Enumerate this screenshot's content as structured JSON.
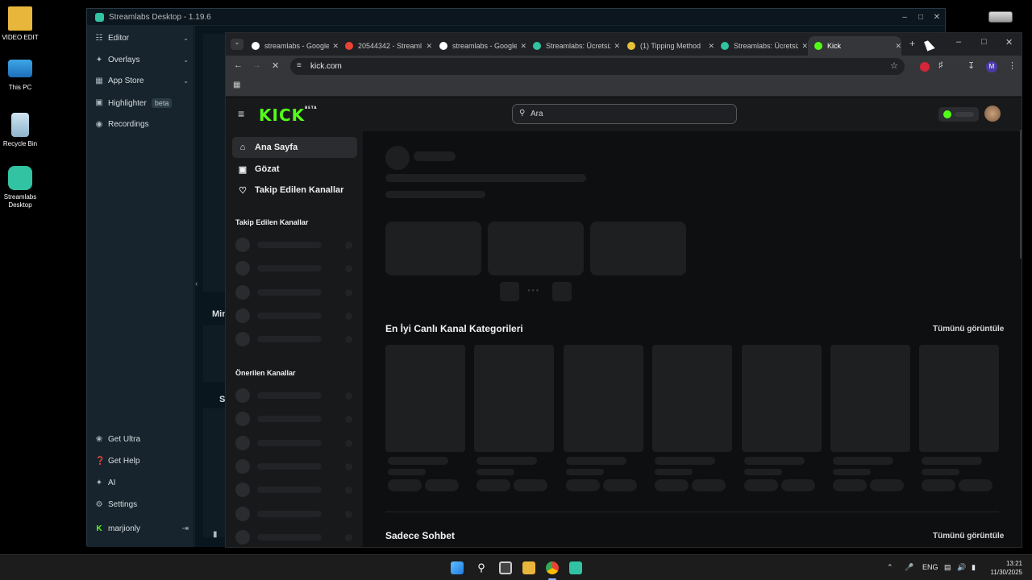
{
  "desktop": {
    "icons": [
      {
        "label": "VIDEO EDIT",
        "icon": "folder-icon"
      },
      {
        "label": "This PC",
        "icon": "monitor-icon"
      },
      {
        "label": "Recycle Bin",
        "icon": "recycle-bin-icon"
      },
      {
        "label": "Streamlabs Desktop",
        "icon": "streamlabs-icon"
      }
    ]
  },
  "streamlabs": {
    "title": "Streamlabs Desktop - 1.19.6",
    "nav": [
      {
        "label": "Editor"
      },
      {
        "label": "Overlays"
      },
      {
        "label": "App Store"
      },
      {
        "label": "Highlighter",
        "badge": "beta"
      },
      {
        "label": "Recordings"
      }
    ],
    "bottom_nav": [
      {
        "label": "Get Ultra"
      },
      {
        "label": "Get Help"
      },
      {
        "label": "AI"
      },
      {
        "label": "Settings"
      }
    ],
    "user": "marjionly",
    "partial_labels": {
      "min": "Min",
      "s": "S"
    }
  },
  "chrome": {
    "tabs": [
      {
        "title": "streamlabs - Google",
        "fav_color": "#ffffff"
      },
      {
        "title": "20544342 - Streaml",
        "fav_color": "#ea4335"
      },
      {
        "title": "streamlabs - Google",
        "fav_color": "#ffffff"
      },
      {
        "title": "Streamlabs: Ücretsiz",
        "fav_color": "#31c3a2"
      },
      {
        "title": "(1) Tipping Method",
        "fav_color": "#e8c13a"
      },
      {
        "title": "Streamlabs: Ücretsiz",
        "fav_color": "#31c3a2"
      },
      {
        "title": "Kick",
        "fav_color": "#53fc18"
      }
    ],
    "url": "kick.com",
    "profile_initial": "M"
  },
  "kick": {
    "logo": "KICK",
    "logo_badge": "BETA",
    "search_placeholder": "Ara",
    "nav": [
      {
        "label": "Ana Sayfa",
        "icon": "home-icon"
      },
      {
        "label": "Gözat",
        "icon": "browse-icon"
      },
      {
        "label": "Takip Edilen Kanallar",
        "icon": "heart-icon"
      }
    ],
    "followed_title": "Takip Edilen Kanallar",
    "recommended_title": "Önerilen Kanallar",
    "categories_title": "En İyi Canlı Kanal Kategorileri",
    "categories_link": "Tümünü görüntüle",
    "chat_title": "Sadece Sohbet",
    "chat_link": "Tümünü görüntüle"
  },
  "taskbar": {
    "lang": "ENG",
    "time": "13:21",
    "date": "11/30/2025"
  }
}
